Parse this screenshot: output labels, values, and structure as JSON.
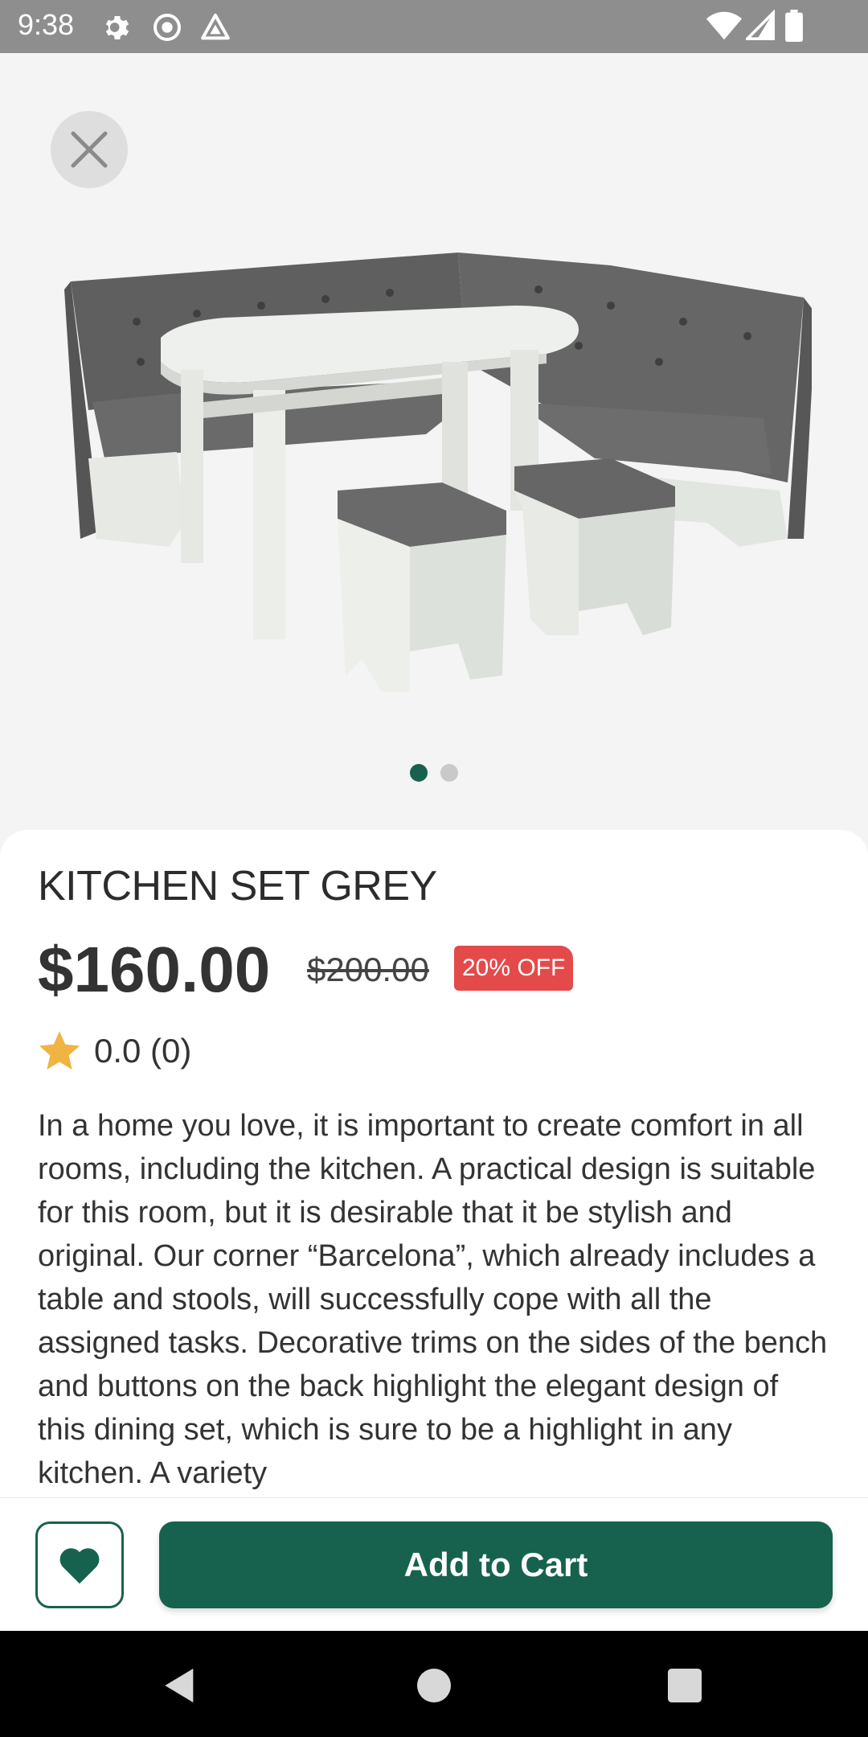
{
  "status_bar": {
    "time": "9:38",
    "icons": [
      "gear-icon",
      "record-icon",
      "drive-icon",
      "wifi-icon",
      "signal-icon",
      "battery-icon"
    ]
  },
  "hero": {
    "close_icon": "close-icon",
    "image_alt": "kitchen-set-grey",
    "carousel": {
      "total": 2,
      "active_index": 0
    }
  },
  "product": {
    "title": "KITCHEN SET GREY",
    "price": "$160.00",
    "original_price": "$200.00",
    "discount_badge": "20% OFF",
    "rating": "0.0 (0)",
    "description": "In a home you love, it is important to create comfort in all rooms, including the kitchen. A practical design is suitable for this room, but it is desirable that it be stylish and original. Our corner “Barcelona”, which already includes a table and stools, will successfully cope with all the assigned tasks.  Decorative trims on the sides of the bench and buttons on the back highlight the elegant design of this dining set, which is sure to be a highlight in any kitchen. A variety"
  },
  "actions": {
    "favorite_icon": "heart-icon",
    "add_to_cart": "Add to Cart"
  },
  "colors": {
    "accent": "#17624f",
    "badge": "#e44a4a",
    "star": "#f0b443"
  }
}
